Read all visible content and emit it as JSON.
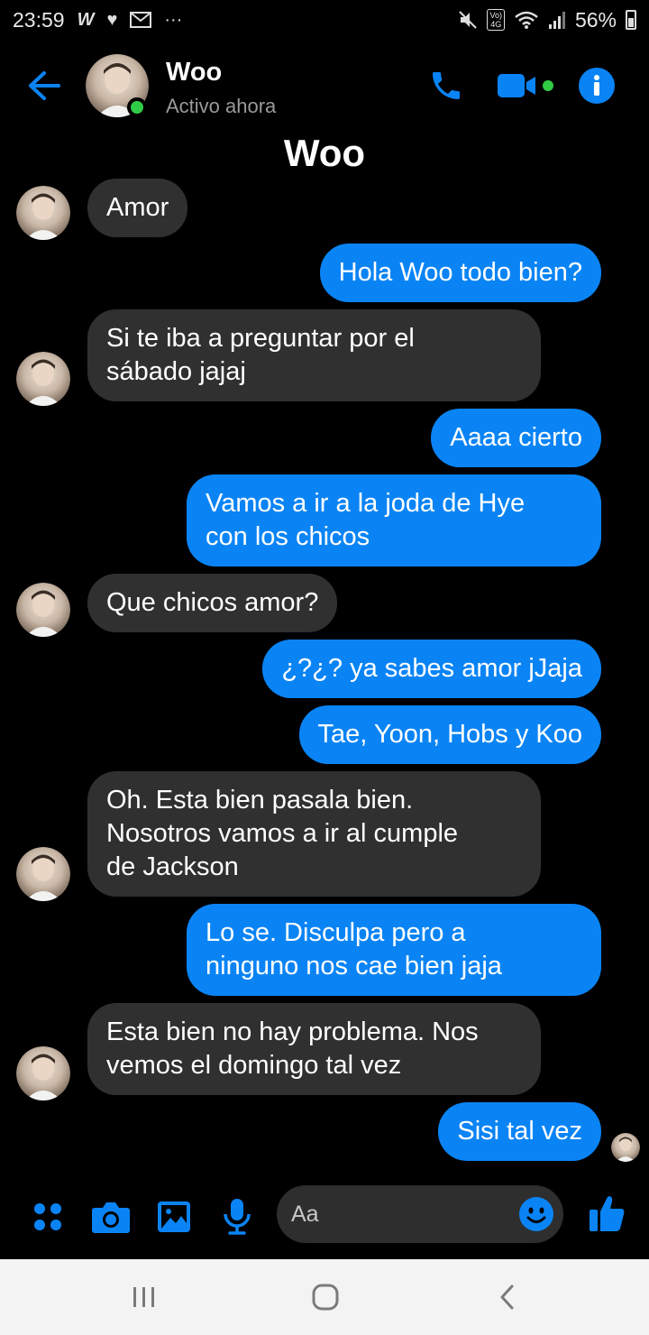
{
  "status_bar": {
    "time": "23:59",
    "battery": "56%",
    "icons": [
      "w-app-icon",
      "heart-icon",
      "gmail-icon",
      "more-icon",
      "mute-icon",
      "volte-icon",
      "wifi-icon",
      "signal-icon",
      "battery-icon"
    ],
    "volte_label": "Vo) 4G"
  },
  "header": {
    "name": "Woo",
    "status": "Activo ahora",
    "actions": [
      "call",
      "video-call",
      "info"
    ]
  },
  "chat_title": "Woo",
  "messages": [
    {
      "from": "them",
      "text": "Amor"
    },
    {
      "from": "me",
      "text": "Hola Woo todo bien?"
    },
    {
      "from": "them",
      "text": "Si te iba a preguntar por el\nsábado jajaj"
    },
    {
      "from": "me",
      "text": "Aaaa cierto"
    },
    {
      "from": "me",
      "text": "Vamos a ir a la joda de Hye\ncon los chicos"
    },
    {
      "from": "them",
      "text": "Que chicos amor?"
    },
    {
      "from": "me",
      "text": "¿?¿? ya sabes amor jJaja"
    },
    {
      "from": "me",
      "text": "Tae, Yoon, Hobs y Koo"
    },
    {
      "from": "them",
      "text": "Oh. Esta bien pasala bien.\nNosotros vamos a ir al cumple\nde Jackson"
    },
    {
      "from": "me",
      "text": "Lo se. Disculpa pero a\nninguno nos cae bien jaja"
    },
    {
      "from": "them",
      "text": "Esta bien no hay problema. Nos\nvemos el domingo tal vez"
    },
    {
      "from": "me",
      "text": "Sisi tal vez"
    }
  ],
  "composer": {
    "placeholder": "Aa",
    "buttons": [
      "menu-dots",
      "camera",
      "gallery",
      "microphone",
      "emoji",
      "like"
    ]
  },
  "colors": {
    "accent": "#0a84f5",
    "incoming_bubble": "#303030",
    "background": "#000000",
    "online": "#31cc46"
  }
}
